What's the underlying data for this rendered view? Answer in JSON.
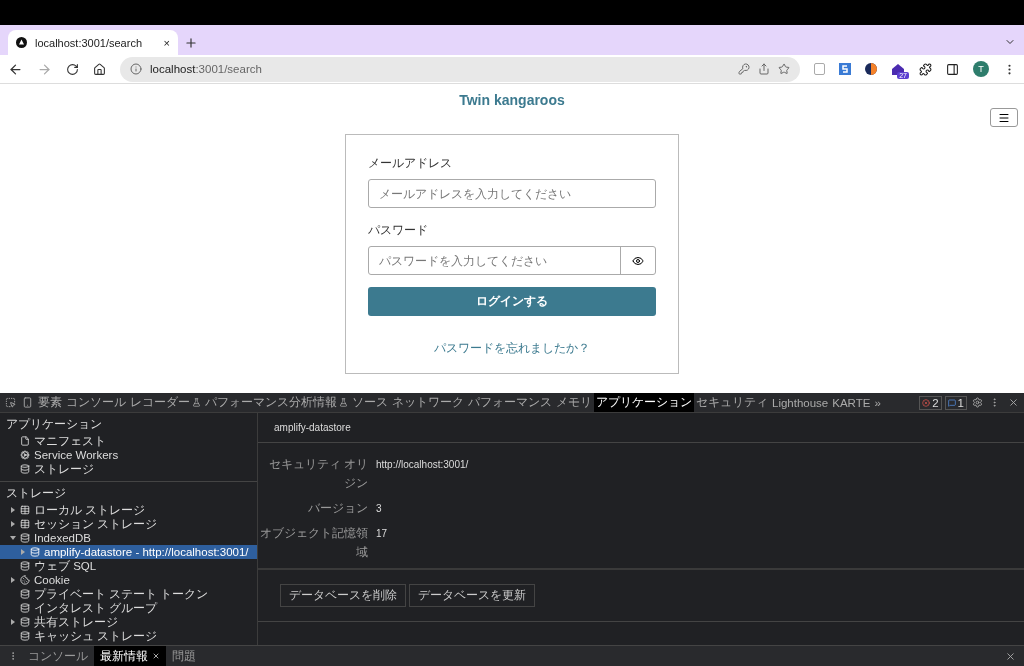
{
  "browser": {
    "tab": {
      "title": "localhost:3001/search",
      "close": "×"
    },
    "address": {
      "host": "localhost",
      "path": ":3001/search"
    },
    "extension_badge": "27",
    "profile": "T"
  },
  "page": {
    "site_title": "Twin kangaroos",
    "form": {
      "email_label": "メールアドレス",
      "email_placeholder": "メールアドレスを入力してください",
      "password_label": "パスワード",
      "password_placeholder": "パスワードを入力してください",
      "login_button": "ログインする",
      "forgot_link": "パスワードを忘れましたか？"
    }
  },
  "devtools": {
    "tabs": [
      {
        "label": "要素",
        "selected": false,
        "experimental": false
      },
      {
        "label": "コンソール",
        "selected": false,
        "experimental": false
      },
      {
        "label": "レコーダー",
        "selected": false,
        "experimental": true
      },
      {
        "label": "パフォーマンス分析情報",
        "selected": false,
        "experimental": true
      },
      {
        "label": "ソース",
        "selected": false,
        "experimental": false
      },
      {
        "label": "ネットワーク",
        "selected": false,
        "experimental": false
      },
      {
        "label": "パフォーマンス",
        "selected": false,
        "experimental": false
      },
      {
        "label": "メモリ",
        "selected": false,
        "experimental": false
      },
      {
        "label": "アプリケーション",
        "selected": true,
        "experimental": false
      },
      {
        "label": "セキュリティ",
        "selected": false,
        "experimental": false
      },
      {
        "label": "Lighthouse",
        "selected": false,
        "experimental": false
      },
      {
        "label": "KARTE",
        "selected": false,
        "experimental": false
      }
    ],
    "more": "»",
    "errors": "2",
    "messages": "1",
    "sidebar": [
      {
        "title": "アプリケーション",
        "items": [
          {
            "label": "マニフェスト",
            "kind": "file",
            "selected": false
          },
          {
            "label": "Service Workers",
            "kind": "worker",
            "selected": false
          },
          {
            "label": "ストレージ",
            "kind": "database",
            "selected": false
          }
        ]
      },
      {
        "title": "ストレージ",
        "items": [
          {
            "label": "ローカル ストレージ",
            "kind": "table",
            "expanded": false,
            "selected": false
          },
          {
            "label": "セッション ストレージ",
            "kind": "table",
            "expanded": false,
            "selected": false
          },
          {
            "label": "IndexedDB",
            "kind": "database",
            "expanded": true,
            "selected": false,
            "children": [
              {
                "label": "amplify-datastore - http://localhost:3001/",
                "kind": "database",
                "expanded": false,
                "selected": true
              }
            ]
          },
          {
            "label": "ウェブ SQL",
            "kind": "database",
            "selected": false
          },
          {
            "label": "Cookie",
            "kind": "cookie",
            "expanded": false,
            "selected": false
          },
          {
            "label": "プライベート ステート トークン",
            "kind": "database",
            "selected": false
          },
          {
            "label": "インタレスト グループ",
            "kind": "database",
            "selected": false
          },
          {
            "label": "共有ストレージ",
            "kind": "database",
            "expanded": false,
            "selected": false
          },
          {
            "label": "キャッシュ ストレージ",
            "kind": "database",
            "selected": false
          }
        ]
      }
    ],
    "detail": {
      "title": "amplify-datastore",
      "fields": [
        {
          "label": "セキュリティ オリジン",
          "value": "http://localhost:3001/"
        },
        {
          "label": "バージョン",
          "value": "3"
        },
        {
          "label": "オブジェクト記憶領域",
          "value": "17"
        }
      ],
      "buttons": [
        "データベースを削除",
        "データベースを更新"
      ]
    },
    "drawer_tabs": [
      {
        "label": "コンソール",
        "selected": false,
        "closable": false
      },
      {
        "label": "最新情報",
        "selected": true,
        "closable": true
      },
      {
        "label": "問題",
        "selected": false,
        "closable": false
      }
    ]
  }
}
